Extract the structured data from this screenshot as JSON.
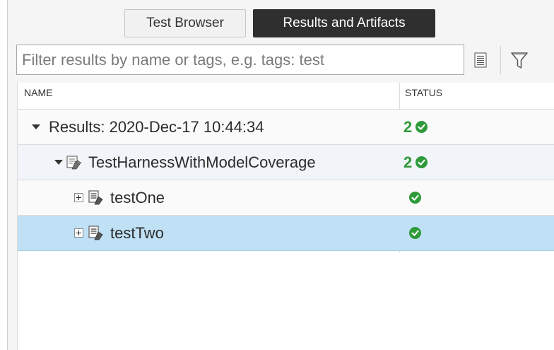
{
  "tabs": {
    "test_browser": "Test Browser",
    "results_artifacts": "Results and Artifacts"
  },
  "filter": {
    "placeholder": "Filter results by name or tags, e.g. tags: test",
    "value": ""
  },
  "table": {
    "col_name": "NAME",
    "col_status": "STATUS",
    "rows": [
      {
        "label": "Results: 2020-Dec-17 10:44:34",
        "count": "2",
        "state": "expanded",
        "status": "passed"
      },
      {
        "label": "TestHarnessWithModelCoverage",
        "count": "2",
        "state": "expanded",
        "status": "passed"
      },
      {
        "label": "testOne",
        "count": "",
        "state": "collapsed",
        "status": "passed"
      },
      {
        "label": "testTwo",
        "count": "",
        "state": "collapsed",
        "status": "passed",
        "selected": true
      }
    ]
  },
  "icons": {
    "list": "list-view-icon",
    "filter": "funnel-filter-icon",
    "passed": "check-circle-icon",
    "suite": "test-suite-icon",
    "test": "test-case-icon"
  },
  "colors": {
    "active_tab": "#2f2f2f",
    "pass_green": "#2e9a3a",
    "selected_row": "#bfe0f5"
  }
}
